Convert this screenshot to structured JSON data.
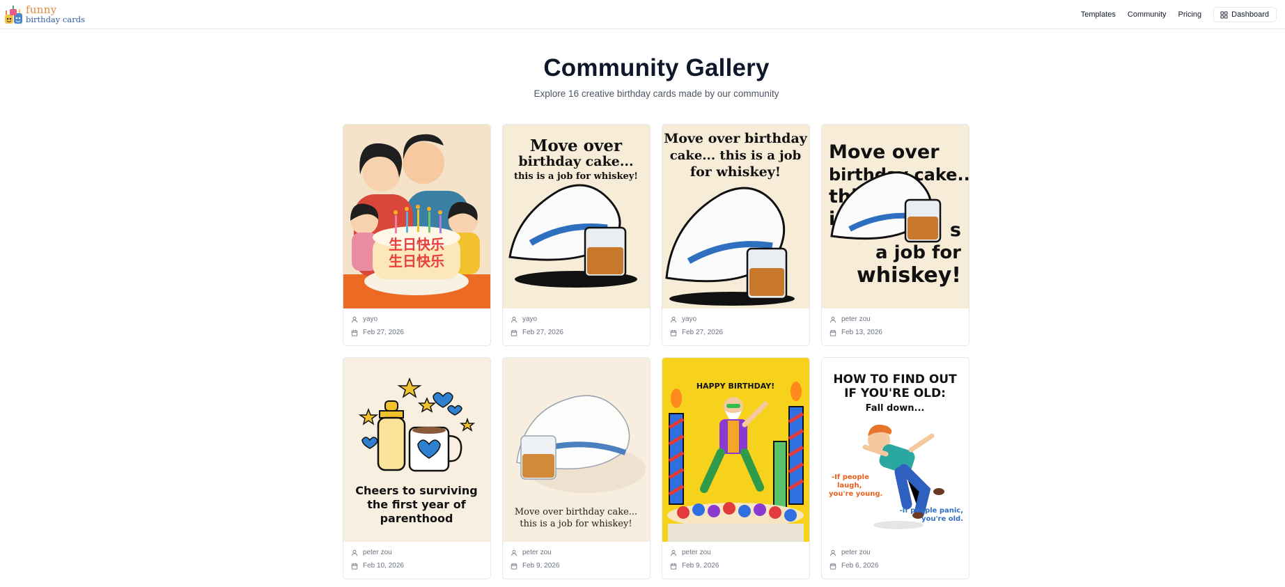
{
  "header": {
    "logo_funny": "funny",
    "logo_cards": "birthday cards",
    "nav": [
      "Templates",
      "Community",
      "Pricing"
    ],
    "dashboard_label": "Dashboard",
    "icons": {
      "dashboard": "layout-grid-icon"
    }
  },
  "page": {
    "title": "Community Gallery",
    "subtitle": "Explore 16 creative birthday cards made by our community"
  },
  "colors": {
    "accent_orange": "#e58a3c",
    "accent_blue": "#2f5f9f",
    "border": "#e5e7eb",
    "muted_text": "#6b7280"
  },
  "cards": [
    {
      "author": "yayo",
      "date": "Feb 27, 2026",
      "art": {
        "text": [
          "生日快乐",
          "生日快乐"
        ]
      }
    },
    {
      "author": "yayo",
      "date": "Feb 27, 2026",
      "art": {
        "text": [
          "Move over",
          "birthday cake...",
          "this is a job for whiskey!"
        ]
      }
    },
    {
      "author": "yayo",
      "date": "Feb 27, 2026",
      "art": {
        "text": [
          "Move over birthday",
          "cake... this is a job",
          "for whiskey!"
        ]
      }
    },
    {
      "author": "peter zou",
      "date": "Feb 13, 2026",
      "art": {
        "text": [
          "Move over",
          "birthday cake...",
          "thi",
          "is",
          "s",
          "a job for",
          "whiskey!"
        ]
      }
    },
    {
      "author": "peter zou",
      "date": "Feb 10, 2026",
      "art": {
        "text": [
          "Cheers to surviving",
          "the first year of",
          "parenthood"
        ]
      }
    },
    {
      "author": "peter zou",
      "date": "Feb 9, 2026",
      "art": {
        "text": [
          "Move over birthday cake...",
          "this is a job for whiskey!"
        ]
      }
    },
    {
      "author": "peter zou",
      "date": "Feb 9, 2026",
      "art": {
        "text": [
          "HAPPY BIRTHDAY!"
        ]
      }
    },
    {
      "author": "peter zou",
      "date": "Feb 6, 2026",
      "art": {
        "text": [
          "HOW TO FIND OUT",
          "IF YOU'RE OLD:",
          "Fall down...",
          "-If people",
          "laugh,",
          "you're young.",
          "-If people panic,",
          "you're old."
        ]
      }
    }
  ]
}
